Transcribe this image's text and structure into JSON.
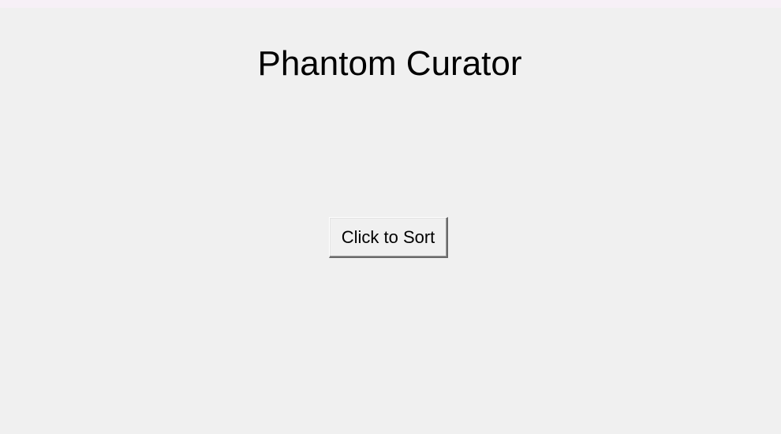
{
  "app": {
    "title": "Phantom Curator"
  },
  "controls": {
    "sort_button_label": "Click to Sort"
  },
  "colors": {
    "background": "#f0f0f0",
    "top_strip": "#f7f0f7",
    "text": "#000000"
  }
}
